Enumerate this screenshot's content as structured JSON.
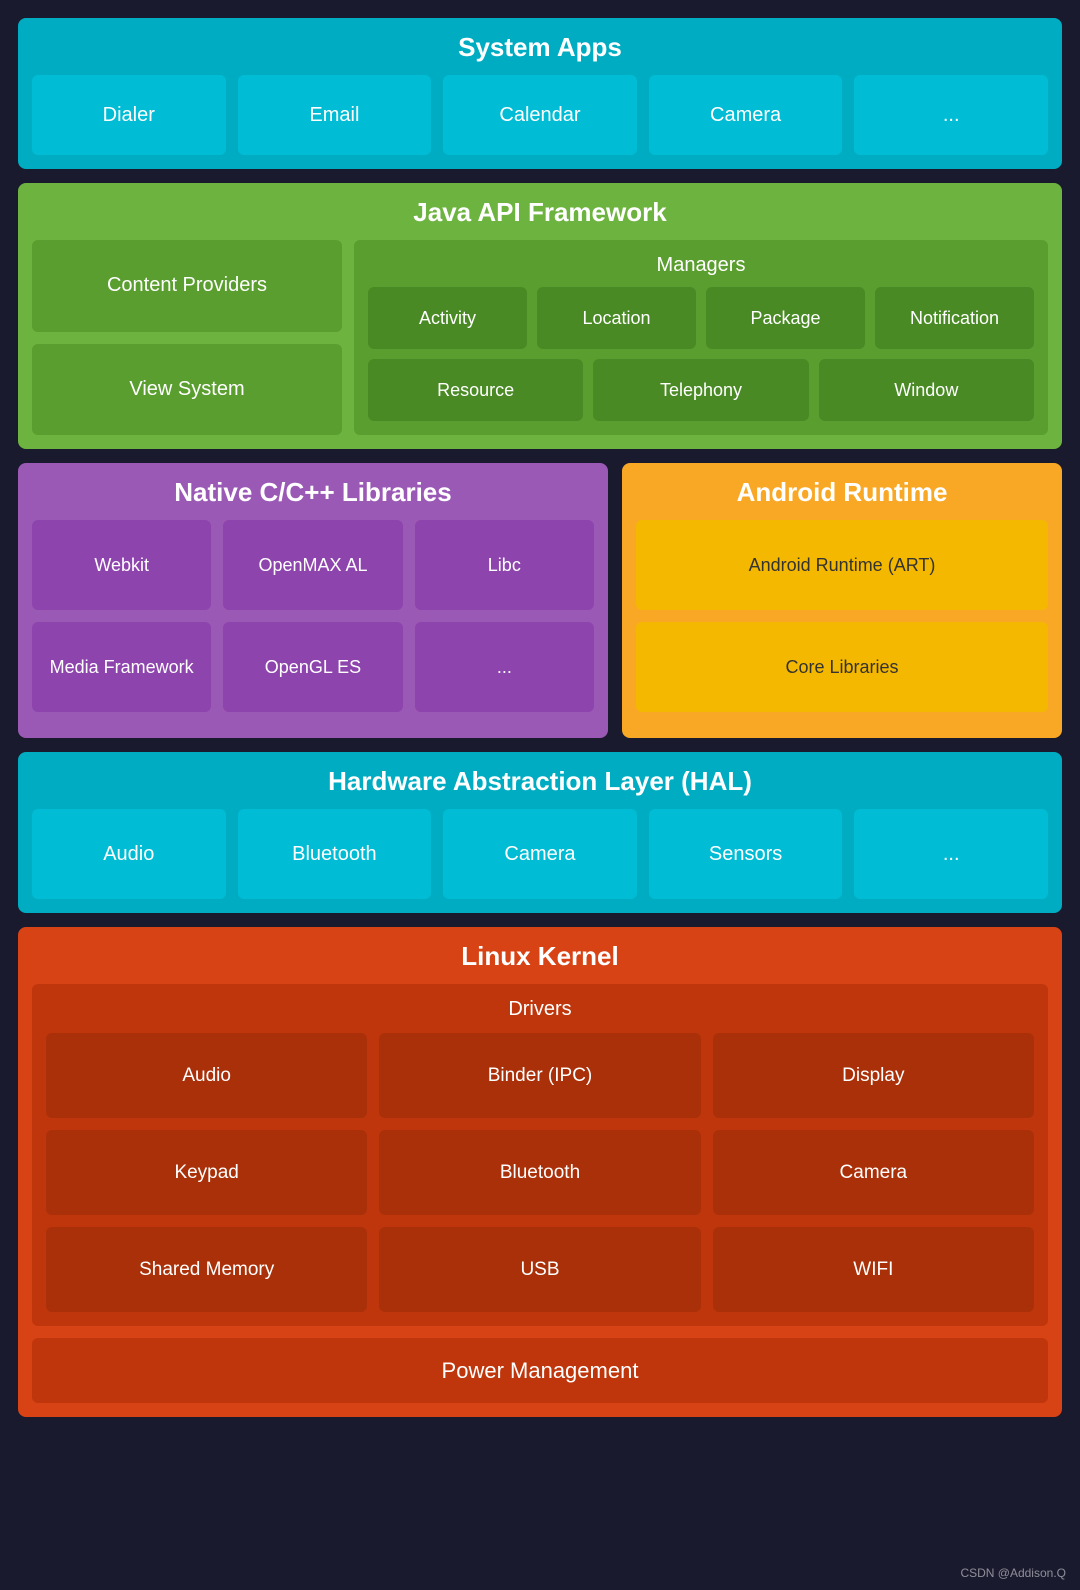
{
  "system_apps": {
    "title": "System Apps",
    "cards": [
      "Dialer",
      "Email",
      "Calendar",
      "Camera",
      "..."
    ]
  },
  "java_api": {
    "title": "Java API Framework",
    "left": [
      "Content Providers",
      "View System"
    ],
    "managers": {
      "title": "Managers",
      "row1": [
        "Activity",
        "Location",
        "Package",
        "Notification"
      ],
      "row2": [
        "Resource",
        "Telephony",
        "Window"
      ]
    }
  },
  "native_libs": {
    "title": "Native C/C++ Libraries",
    "cards": [
      "Webkit",
      "OpenMAX AL",
      "Libc",
      "Media Framework",
      "OpenGL ES",
      "..."
    ]
  },
  "android_runtime": {
    "title": "Android Runtime",
    "cards": [
      "Android Runtime (ART)",
      "Core Libraries"
    ]
  },
  "hal": {
    "title": "Hardware Abstraction Layer (HAL)",
    "cards": [
      "Audio",
      "Bluetooth",
      "Camera",
      "Sensors",
      "..."
    ]
  },
  "linux_kernel": {
    "title": "Linux Kernel",
    "drivers_title": "Drivers",
    "drivers": [
      "Audio",
      "Binder (IPC)",
      "Display",
      "Keypad",
      "Bluetooth",
      "Camera",
      "Shared Memory",
      "USB",
      "WIFI"
    ],
    "power_mgmt": "Power Management"
  },
  "watermark": "CSDN @Addison.Q"
}
